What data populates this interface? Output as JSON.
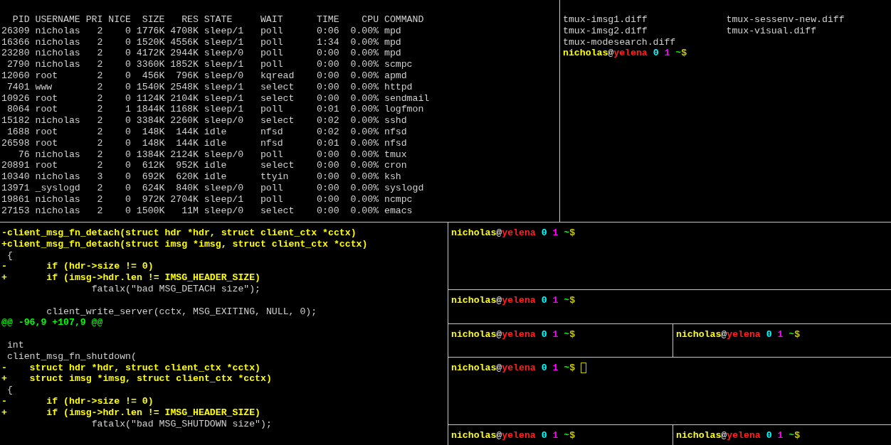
{
  "process_table": {
    "columns": [
      "PID",
      "USERNAME",
      "PRI",
      "NICE",
      "SIZE",
      "RES",
      "STATE",
      "WAIT",
      "TIME",
      "CPU",
      "COMMAND"
    ],
    "rows": [
      [
        "26309",
        "nicholas",
        "2",
        "0",
        "1776K",
        "4708K",
        "sleep/1",
        "poll",
        "0:06",
        "0.00%",
        "mpd"
      ],
      [
        "16366",
        "nicholas",
        "2",
        "0",
        "1520K",
        "4556K",
        "sleep/1",
        "poll",
        "1:34",
        "0.00%",
        "mpd"
      ],
      [
        "23280",
        "nicholas",
        "2",
        "0",
        "4172K",
        "2944K",
        "sleep/0",
        "poll",
        "0:00",
        "0.00%",
        "mpd"
      ],
      [
        "2790",
        "nicholas",
        "2",
        "0",
        "3360K",
        "1852K",
        "sleep/1",
        "poll",
        "0:00",
        "0.00%",
        "scmpc"
      ],
      [
        "12060",
        "root",
        "2",
        "0",
        "456K",
        "796K",
        "sleep/0",
        "kqread",
        "0:00",
        "0.00%",
        "apmd"
      ],
      [
        "7401",
        "www",
        "2",
        "0",
        "1540K",
        "2548K",
        "sleep/1",
        "select",
        "0:00",
        "0.00%",
        "httpd"
      ],
      [
        "10926",
        "root",
        "2",
        "0",
        "1124K",
        "2104K",
        "sleep/1",
        "select",
        "0:00",
        "0.00%",
        "sendmail"
      ],
      [
        "8064",
        "root",
        "2",
        "1",
        "1844K",
        "1168K",
        "sleep/1",
        "poll",
        "0:01",
        "0.00%",
        "logfmon"
      ],
      [
        "15182",
        "nicholas",
        "2",
        "0",
        "3384K",
        "2260K",
        "sleep/0",
        "select",
        "0:02",
        "0.00%",
        "sshd"
      ],
      [
        "1688",
        "root",
        "2",
        "0",
        "148K",
        "144K",
        "idle",
        "nfsd",
        "0:02",
        "0.00%",
        "nfsd"
      ],
      [
        "26598",
        "root",
        "2",
        "0",
        "148K",
        "144K",
        "idle",
        "nfsd",
        "0:01",
        "0.00%",
        "nfsd"
      ],
      [
        "76",
        "nicholas",
        "2",
        "0",
        "1384K",
        "2124K",
        "sleep/0",
        "poll",
        "0:00",
        "0.00%",
        "tmux"
      ],
      [
        "20891",
        "root",
        "2",
        "0",
        "612K",
        "952K",
        "idle",
        "select",
        "0:00",
        "0.00%",
        "cron"
      ],
      [
        "10340",
        "nicholas",
        "3",
        "0",
        "692K",
        "620K",
        "idle",
        "ttyin",
        "0:00",
        "0.00%",
        "ksh"
      ],
      [
        "13971",
        "_syslogd",
        "2",
        "0",
        "624K",
        "840K",
        "sleep/0",
        "poll",
        "0:00",
        "0.00%",
        "syslogd"
      ],
      [
        "19861",
        "nicholas",
        "2",
        "0",
        "972K",
        "2704K",
        "sleep/1",
        "poll",
        "0:00",
        "0.00%",
        "ncmpc"
      ],
      [
        "27153",
        "nicholas",
        "2",
        "0",
        "1500K",
        "11M",
        "sleep/0",
        "select",
        "0:00",
        "0.00%",
        "emacs"
      ]
    ]
  },
  "file_listing": {
    "files": [
      "tmux-imsg1.diff",
      "tmux-sessenv-new.diff",
      "tmux-imsg2.diff",
      "tmux-visual.diff",
      "tmux-modesearch.diff"
    ],
    "prompt": {
      "user": "nicholas",
      "at": "@",
      "host": "yelena",
      "number_1": "0",
      "number_2": "1",
      "dir": "~",
      "symbol": "$"
    }
  },
  "diff": [
    {
      "kind": "removed",
      "text": "-client_msg_fn_detach(struct hdr *hdr, struct client_ctx *cctx)"
    },
    {
      "kind": "added",
      "text": "+client_msg_fn_detach(struct imsg *imsg, struct client_ctx *cctx)"
    },
    {
      "kind": "context",
      "text": " {"
    },
    {
      "kind": "removed",
      "text": "-\tif (hdr->size != 0)"
    },
    {
      "kind": "added",
      "text": "+\tif (imsg->hdr.len != IMSG_HEADER_SIZE)"
    },
    {
      "kind": "context",
      "text": " \t\tfatalx(\"bad MSG_DETACH size\");"
    },
    {
      "kind": "blank"
    },
    {
      "kind": "context",
      "text": " \tclient_write_server(cctx, MSG_EXITING, NULL, 0);"
    },
    {
      "kind": "hunk",
      "text": "@@ -96,9 +107,9 @@"
    },
    {
      "kind": "blank"
    },
    {
      "kind": "context",
      "text": " int"
    },
    {
      "kind": "context",
      "text": " client_msg_fn_shutdown("
    },
    {
      "kind": "removed",
      "text": "-    struct hdr *hdr, struct client_ctx *cctx)"
    },
    {
      "kind": "added",
      "text": "+    struct imsg *imsg, struct client_ctx *cctx)"
    },
    {
      "kind": "context",
      "text": " {"
    },
    {
      "kind": "removed",
      "text": "-\tif (hdr->size != 0)"
    },
    {
      "kind": "added",
      "text": "+\tif (imsg->hdr.len != IMSG_HEADER_SIZE)"
    },
    {
      "kind": "context",
      "text": " \t\tfatalx(\"bad MSG_SHUTDOWN size\");"
    }
  ],
  "shell_panes": [
    {
      "panes": [
        {
          "prompt": {
            "user": "nicholas",
            "at": "@",
            "host": "yelena",
            "number_1": "0",
            "number_2": "1",
            "dir": "~",
            "symbol": "$"
          },
          "cursor": false
        }
      ]
    },
    {
      "panes": [
        {
          "prompt": {
            "user": "nicholas",
            "at": "@",
            "host": "yelena",
            "number_1": "0",
            "number_2": "1",
            "dir": "~",
            "symbol": "$"
          },
          "cursor": false
        }
      ]
    },
    {
      "panes": [
        {
          "prompt": {
            "user": "nicholas",
            "at": "@",
            "host": "yelena",
            "number_1": "0",
            "number_2": "1",
            "dir": "~",
            "symbol": "$"
          },
          "cursor": false
        },
        {
          "prompt": {
            "user": "nicholas",
            "at": "@",
            "host": "yelena",
            "number_1": "0",
            "number_2": "1",
            "dir": "~",
            "symbol": "$"
          },
          "cursor": false
        }
      ]
    },
    {
      "panes": [
        {
          "prompt": {
            "user": "nicholas",
            "at": "@",
            "host": "yelena",
            "number_1": "0",
            "number_2": "1",
            "dir": "~",
            "symbol": "$"
          },
          "cursor": true
        }
      ]
    },
    {
      "panes": [
        {
          "prompt": {
            "user": "nicholas",
            "at": "@",
            "host": "yelena",
            "number_1": "0",
            "number_2": "1",
            "dir": "~",
            "symbol": "$"
          },
          "cursor": false
        },
        {
          "prompt": {
            "user": "nicholas",
            "at": "@",
            "host": "yelena",
            "number_1": "0",
            "number_2": "1",
            "dir": "~",
            "symbol": "$"
          },
          "cursor": false
        }
      ]
    }
  ]
}
